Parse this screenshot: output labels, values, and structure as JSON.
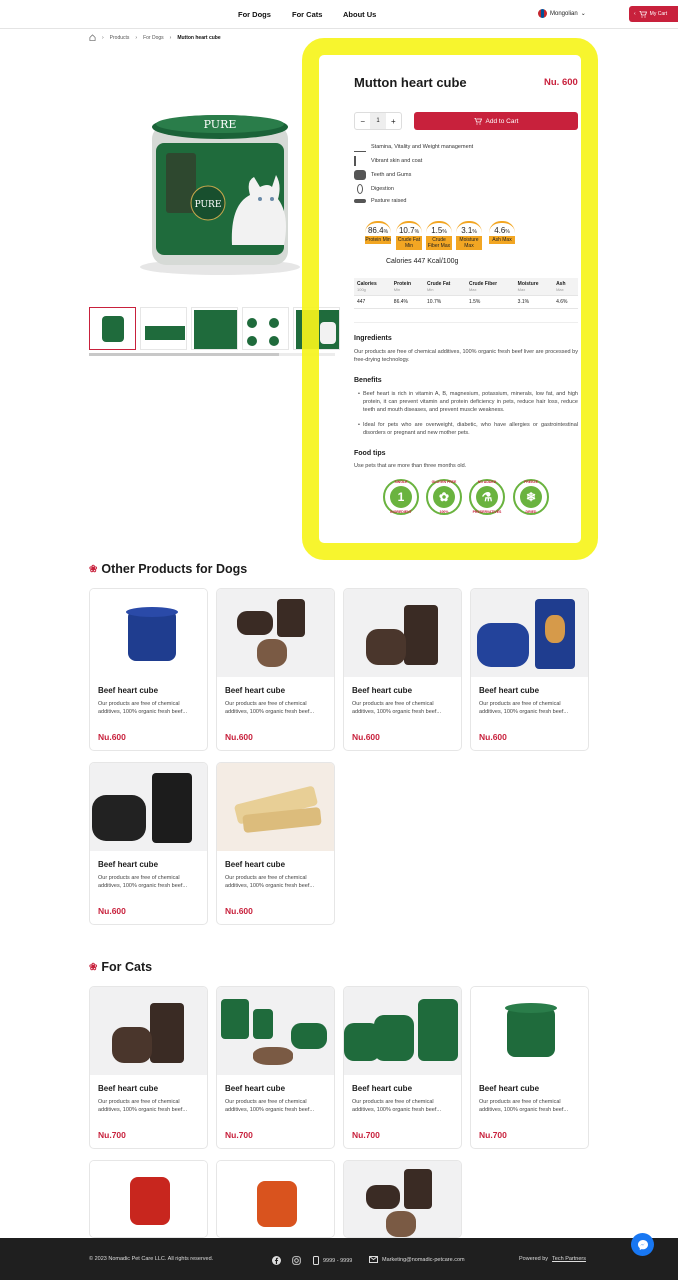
{
  "header": {
    "nav": [
      "For Dogs",
      "For Cats",
      "About Us"
    ],
    "language": "Mongolian",
    "cart_label": "My Cart"
  },
  "breadcrumb": [
    "Products",
    "For Dogs",
    "Mutton heart cube"
  ],
  "product": {
    "title": "Mutton heart cube",
    "price": "Nu. 600",
    "quantity": "1",
    "add_to_cart": "Add to Cart",
    "features": [
      "Stamina, Vitality and Weight management",
      "Vibrant skin and coat",
      "Teeth and Gums",
      "Digestion",
      "Pasture raised"
    ],
    "badges": [
      {
        "value": "86.4",
        "unit": "%",
        "label": "Protein Min"
      },
      {
        "value": "10.7",
        "unit": "%",
        "label": "Crude Fat Min"
      },
      {
        "value": "1.5",
        "unit": "%",
        "label": "Crude Fiber Max"
      },
      {
        "value": "3.1",
        "unit": "%",
        "label": "Moisture Max"
      },
      {
        "value": "4.6",
        "unit": "%",
        "label": "Ash Max"
      }
    ],
    "calories_text": "Calories 447 Kcal/100g",
    "table": {
      "headers": [
        {
          "name": "Calories",
          "sub": "100g"
        },
        {
          "name": "Protein",
          "sub": "Min"
        },
        {
          "name": "Crude Fat",
          "sub": "Min"
        },
        {
          "name": "Crude Fiber",
          "sub": "Max"
        },
        {
          "name": "Moisture",
          "sub": "Max"
        },
        {
          "name": "Ash",
          "sub": "Max"
        }
      ],
      "values": [
        "447",
        "86.4%",
        "10.7%",
        "1.5%",
        "3.1%",
        "4.6%"
      ]
    },
    "ingredients_title": "Ingredients",
    "ingredients_text": "Our products are free of chemical additives, 100% organic fresh beef liver are processed by free-drying technology.",
    "benefits_title": "Benefits",
    "benefits": [
      "Beef heart is rich in vitamin A, B, magnesium, potassium, minerals, low fat, and high protein, it can prevent vitamin and protein deficiency in pets, reduce hair loss, reduce teeth and mouth diseases, and prevent muscle weakness.",
      "Ideal for pets who are overweight, diabetic, who have allergies or gastrointestinal disorders or pregnant and new mother pets."
    ],
    "food_tips_title": "Food tips",
    "food_tips_text": "Use pets that are more than three months old.",
    "seals": [
      {
        "top": "SINGLE",
        "center": "1",
        "bottom": "INGREDIENT"
      },
      {
        "top": "GLUTEN FREE",
        "center": "✿",
        "bottom": "100%"
      },
      {
        "top": "NO ADDED",
        "center": "⚗",
        "bottom": "PRESERVATIVES"
      },
      {
        "top": "FREEZE",
        "center": "❄",
        "bottom": "DRIED"
      }
    ]
  },
  "dogs_section": {
    "title": "Other Products for Dogs",
    "products": [
      {
        "name": "Beef heart cube",
        "desc": "Our products are free of chemical additives, 100% organic fresh beef...",
        "price": "Nu.600"
      },
      {
        "name": "Beef heart cube",
        "desc": "Our products are free of chemical additives, 100% organic fresh beef...",
        "price": "Nu.600"
      },
      {
        "name": "Beef heart cube",
        "desc": "Our products are free of chemical additives, 100% organic fresh beef...",
        "price": "Nu.600"
      },
      {
        "name": "Beef heart cube",
        "desc": "Our products are free of chemical additives, 100% organic fresh beef...",
        "price": "Nu.600"
      },
      {
        "name": "Beef heart cube",
        "desc": "Our products are free of chemical additives, 100% organic fresh beef...",
        "price": "Nu.600"
      },
      {
        "name": "Beef heart cube",
        "desc": "Our products are free of chemical additives, 100% organic fresh beef...",
        "price": "Nu.600"
      }
    ]
  },
  "cats_section": {
    "title": "For Cats",
    "products": [
      {
        "name": "Beef heart cube",
        "desc": "Our products are free of chemical additives, 100% organic fresh beef...",
        "price": "Nu.700"
      },
      {
        "name": "Beef heart cube",
        "desc": "Our products are free of chemical additives, 100% organic fresh beef...",
        "price": "Nu.700"
      },
      {
        "name": "Beef heart cube",
        "desc": "Our products are free of chemical additives, 100% organic fresh beef...",
        "price": "Nu.700"
      },
      {
        "name": "Beef heart cube",
        "desc": "Our products are free of chemical additives, 100% organic fresh beef...",
        "price": "Nu.700"
      }
    ]
  },
  "footer": {
    "copyright": "© 2023 Nomadic Pet Care LLC. All rights reserved.",
    "phone": "9999 - 9999",
    "email": "Marketing@nomadic-petcare.com",
    "powered_prefix": "Powered by",
    "powered_link": "Tech Partners"
  },
  "brand_label": "PURE",
  "colors": {
    "accent": "#c8213c",
    "badge": "#f2a623",
    "highlight": "#f6f41c",
    "footer": "#1f1f1f",
    "seal": "#6ab33f"
  }
}
